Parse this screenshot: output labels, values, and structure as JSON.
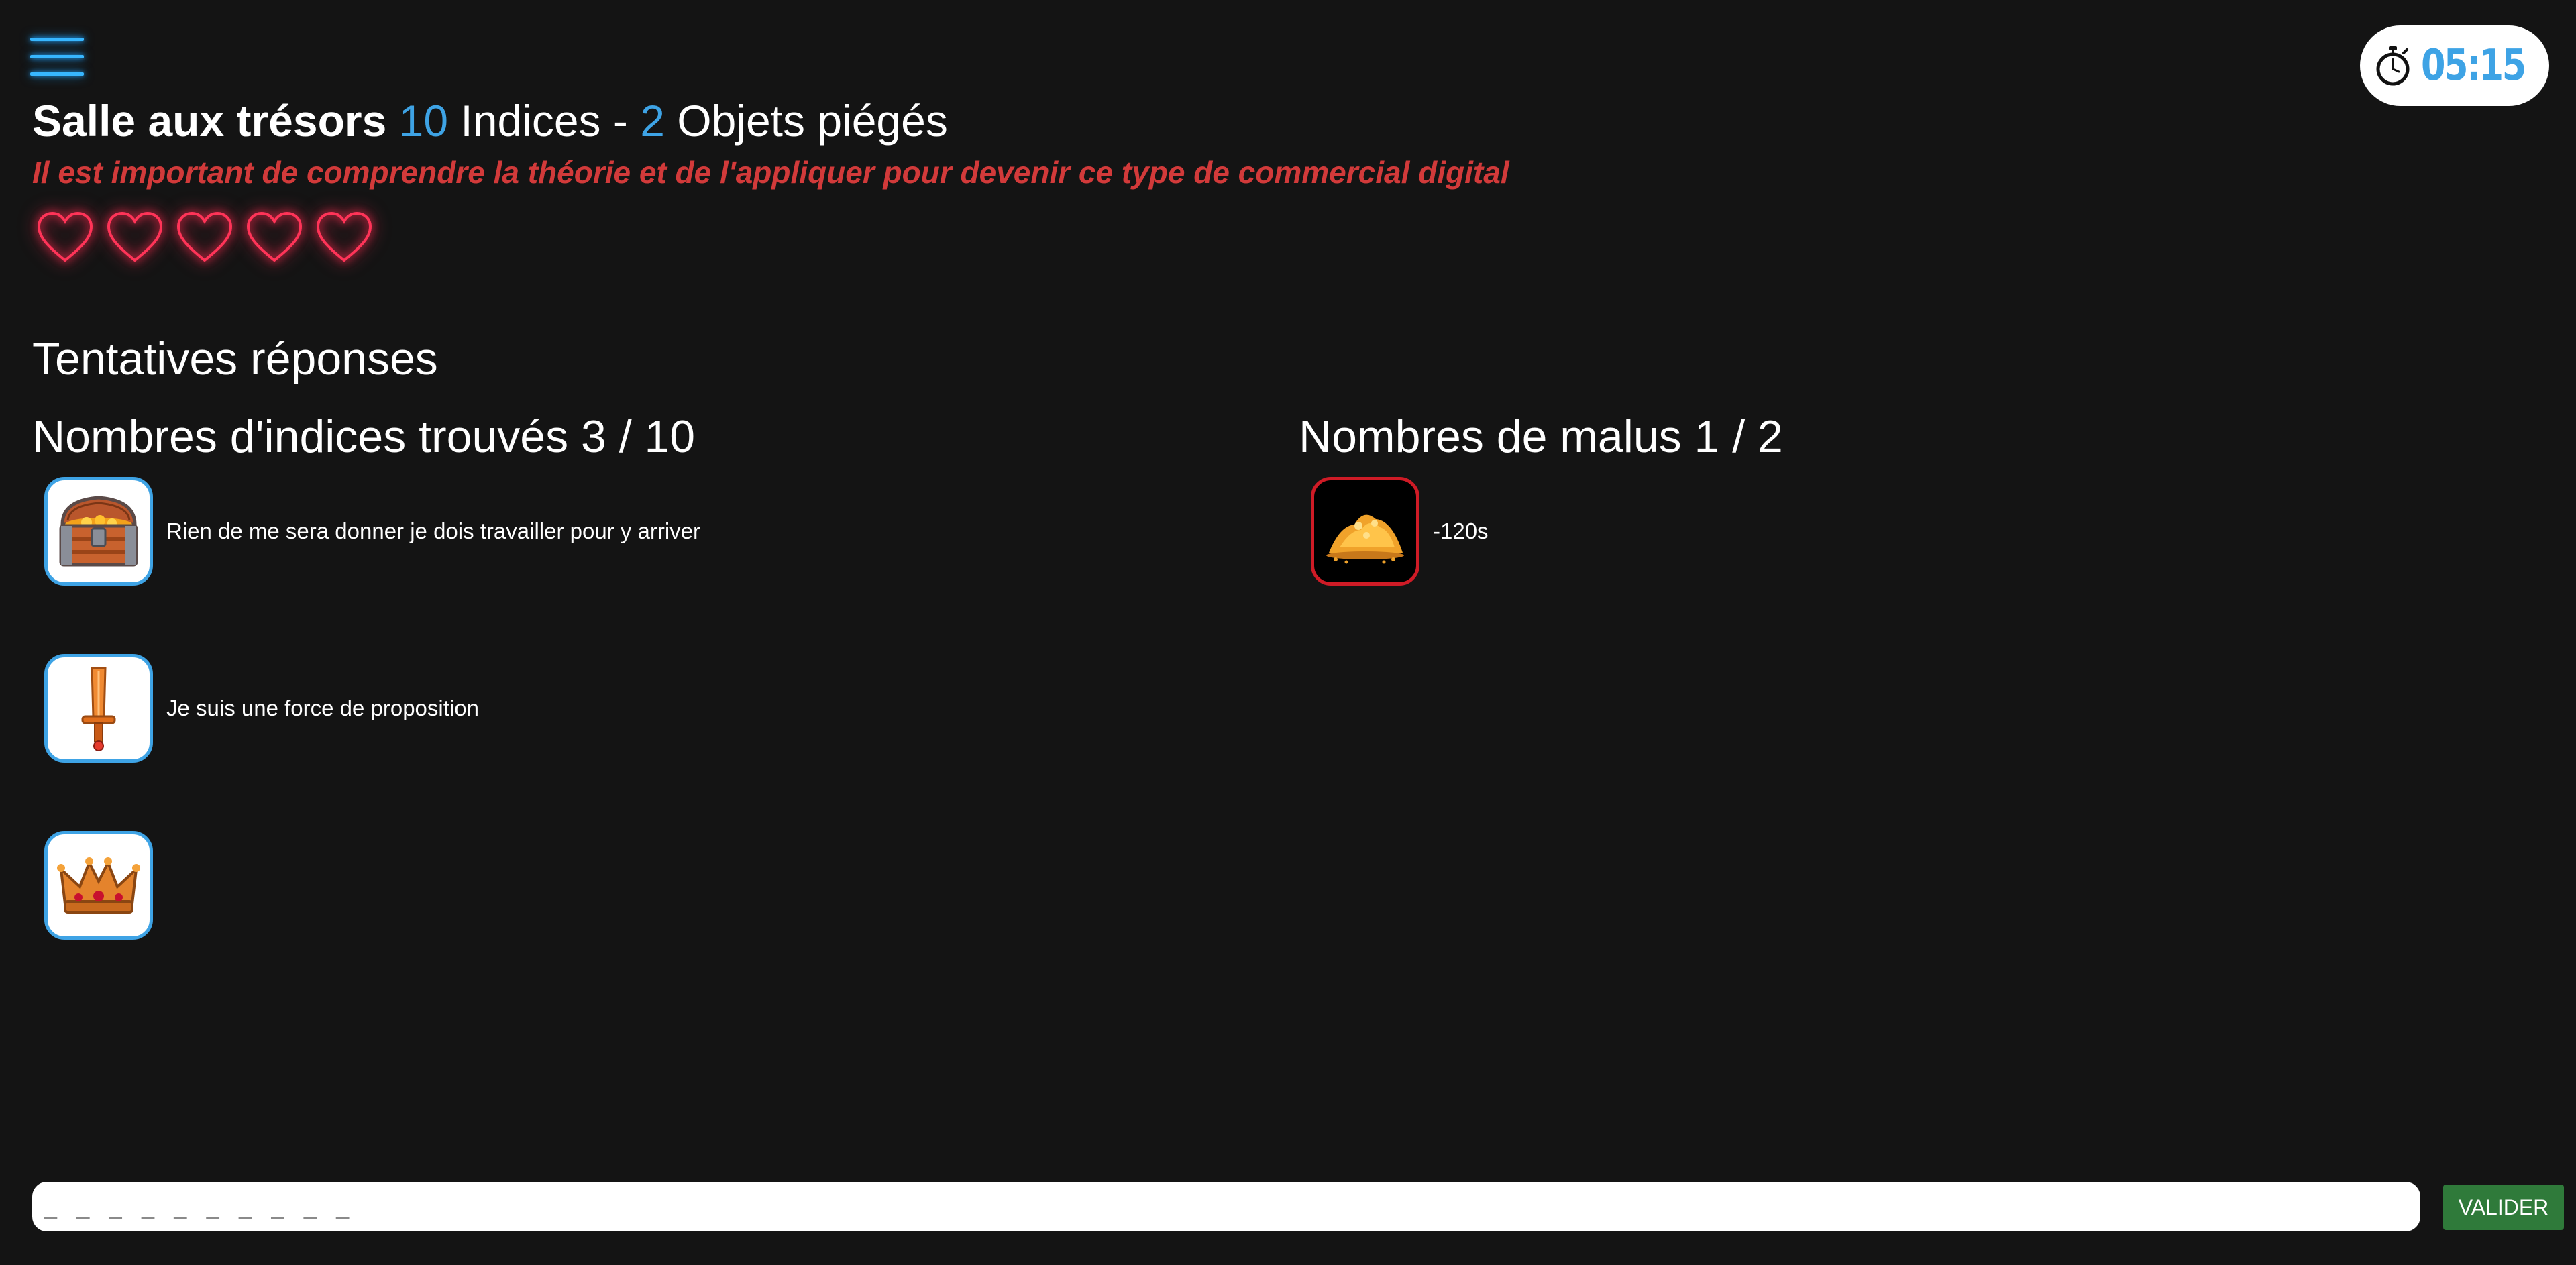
{
  "menu": {
    "icon": "hamburger-menu-icon"
  },
  "timer": {
    "icon": "stopwatch-icon",
    "value": "05:15"
  },
  "header": {
    "title_strong": "Salle aux trésors",
    "hints_count": "10",
    "hints_label": "Indices -",
    "traps_count": "2",
    "traps_label": "Objets piégés",
    "subtitle": "Il est important de comprendre la théorie et de l'appliquer pour devenir ce type de commercial digital",
    "accent_color": "#3ea3e5",
    "subtitle_color": "#d23a3a"
  },
  "lives": {
    "icon": "heart-icon",
    "count": 5,
    "color": "#ff2a4f"
  },
  "attempts": {
    "title": "Tentatives réponses"
  },
  "hints_found": {
    "title": "Nombres d'indices trouvés 3 / 10",
    "items": [
      {
        "icon": "treasure-chest-icon",
        "text": "Rien de me sera donner je dois travailler pour y arriver"
      },
      {
        "icon": "sword-icon",
        "text": "Je suis une force de proposition"
      },
      {
        "icon": "crown-icon",
        "text": ""
      }
    ]
  },
  "malus": {
    "title": "Nombres de malus 1 / 2",
    "items": [
      {
        "icon": "gold-pile-icon",
        "text": "-120s"
      }
    ]
  },
  "answer": {
    "placeholder": "_ _ _ _ _ _ _ _ _ _",
    "submit_label": "VALIDER",
    "submit_color": "#2f7a3a"
  }
}
